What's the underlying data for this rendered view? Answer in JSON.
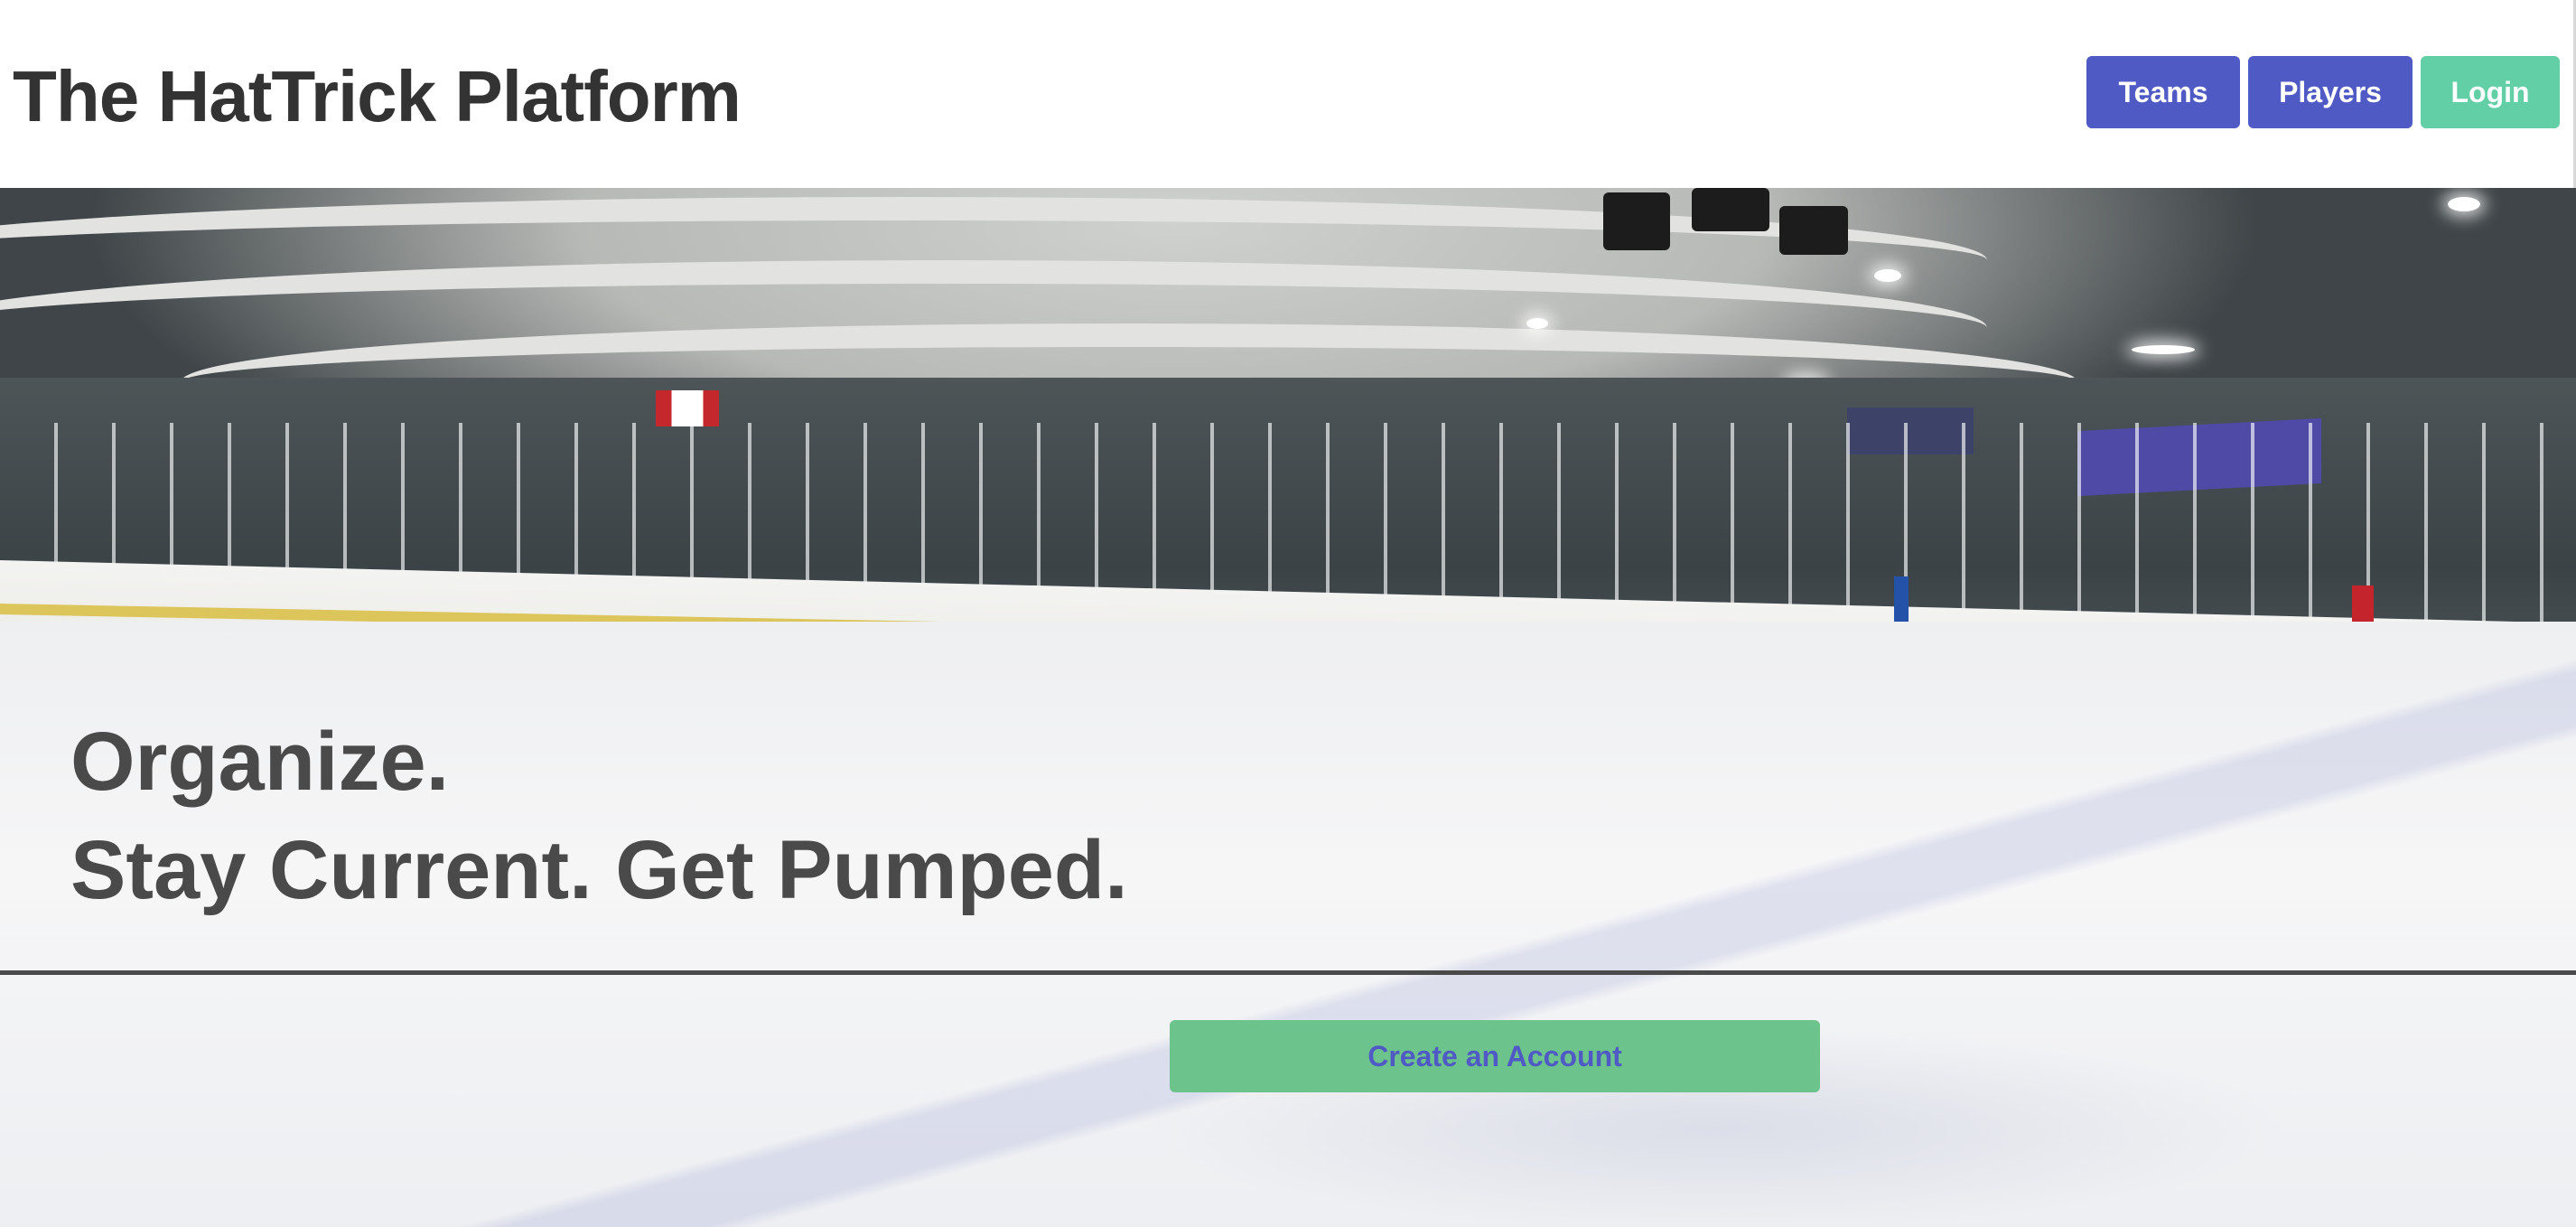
{
  "header": {
    "title": "The HatTrick Platform",
    "nav": {
      "teams_label": "Teams",
      "players_label": "Players",
      "login_label": "Login"
    }
  },
  "hero": {
    "background_image": "ice-rink-photo",
    "tagline_line1": "Organize.",
    "tagline_line2": "Stay Current. Get Pumped.",
    "cta_label": "Create an Account"
  },
  "colors": {
    "nav_primary": "#505ac4",
    "login_green": "#63cfa6",
    "cta_green": "#6cc48c",
    "text_dark": "#333333"
  }
}
